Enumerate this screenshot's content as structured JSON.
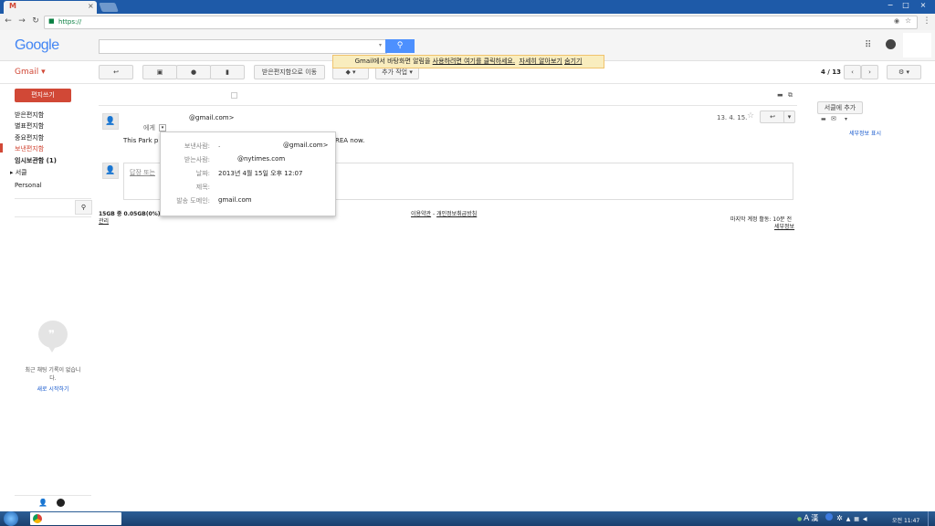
{
  "browser": {
    "tab_icon": "M",
    "close_glyph": "×",
    "url": "https://",
    "window_buttons": [
      "−",
      "□",
      "×"
    ]
  },
  "gmail": {
    "logo": "Google",
    "app_label": "Gmail ▾",
    "banner": {
      "prefix": "Gmail에서 바탕화면 알림을 ",
      "link1": "사용하려면 여기를 클릭하세요.",
      "link2": "자세히 알아보기",
      "link3": "숨기기"
    },
    "toolbar": {
      "move_to_inbox": "받은편지함으로 이동",
      "more": "추가 작업 ▾",
      "page_count": "4 / 13"
    },
    "compose": "편지쓰기",
    "nav": [
      {
        "label": "받은편지함"
      },
      {
        "label": "별표편지함"
      },
      {
        "label": "중요편지함"
      },
      {
        "label": "보낸편지함"
      },
      {
        "label": "임시보관함 (1)"
      },
      {
        "label": "▸ 서클"
      },
      {
        "label": "Personal"
      }
    ],
    "message": {
      "sender": "@gmail.com>",
      "to_label": "에게",
      "date": "13. 4. 15.",
      "snippet_start": "This Park p",
      "snippet_end": "REA now."
    },
    "details_card": {
      "rows": [
        {
          "label": "보낸사람:",
          "value": ".",
          "value2": "@gmail.com>"
        },
        {
          "label": "받는사람:",
          "value": "@nytimes.com"
        },
        {
          "label": "날짜:",
          "value": "2013년 4월 15일 오후 12:07"
        },
        {
          "label": "제목:",
          "value": ""
        },
        {
          "label": "발송 도메인:",
          "value": "gmail.com"
        }
      ]
    },
    "reply_placeholder": "답장 또는",
    "footer": {
      "storage": "15GB 중 0.05GB(0%) 사",
      "manage": "관리",
      "terms": "이용약관",
      "separator": " - ",
      "privacy": "개인정보취급방침",
      "last_activity": "마지막 계정 활동: 10분 전",
      "details": "세부정보"
    },
    "right_panel": {
      "add_to_circles": "서클에 추가",
      "show_details": "세부정보 표시"
    },
    "hangouts": {
      "empty_line1": "최근 채팅 기록이 없습니",
      "empty_line2": "다.",
      "start_new": "새로 시작하기"
    }
  },
  "taskbar": {
    "ime_mode": "A",
    "ime_hanja": "漢",
    "time": "오전 11:47"
  }
}
